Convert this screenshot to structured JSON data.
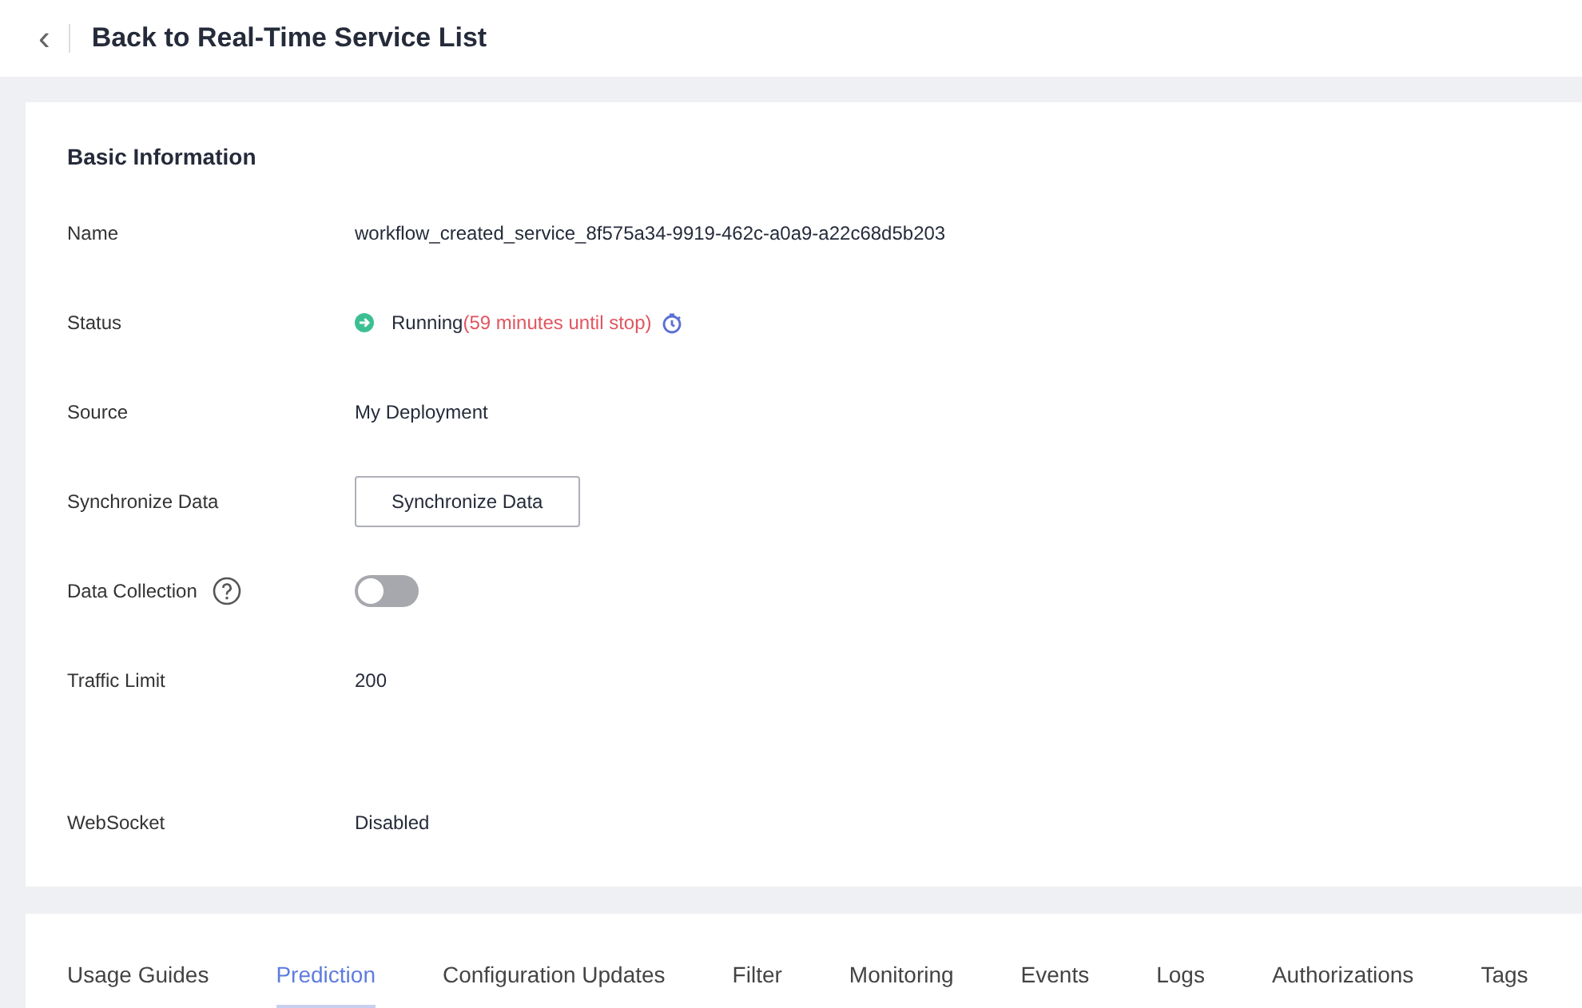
{
  "header": {
    "back_icon": "‹",
    "title": "Back to Real-Time Service List"
  },
  "basic_info": {
    "heading": "Basic Information",
    "fields": [
      {
        "kind": "text",
        "label": "Name",
        "value": "workflow_created_service_8f575a34-9919-462c-a0a9-a22c68d5b203"
      },
      {
        "kind": "status",
        "label": "Status",
        "value": "Running",
        "note": "(59 minutes until stop)"
      },
      {
        "kind": "text",
        "label": "Source",
        "value": "My Deployment"
      },
      {
        "kind": "button",
        "label": "Synchronize Data",
        "value": "Synchronize Data"
      },
      {
        "kind": "toggle",
        "label": "Data Collection",
        "help": true,
        "on": false
      },
      {
        "kind": "text",
        "label": "Traffic Limit",
        "value": "200",
        "spaced": true
      },
      {
        "kind": "text",
        "label": "WebSocket",
        "value": "Disabled"
      }
    ]
  },
  "tabs": [
    {
      "label": "Usage Guides",
      "selected": false
    },
    {
      "label": "Prediction",
      "selected": true
    },
    {
      "label": "Configuration Updates",
      "selected": false
    },
    {
      "label": "Filter",
      "selected": false
    },
    {
      "label": "Monitoring",
      "selected": false
    },
    {
      "label": "Events",
      "selected": false
    },
    {
      "label": "Logs",
      "selected": false
    },
    {
      "label": "Authorizations",
      "selected": false
    },
    {
      "label": "Tags",
      "selected": false
    }
  ]
}
